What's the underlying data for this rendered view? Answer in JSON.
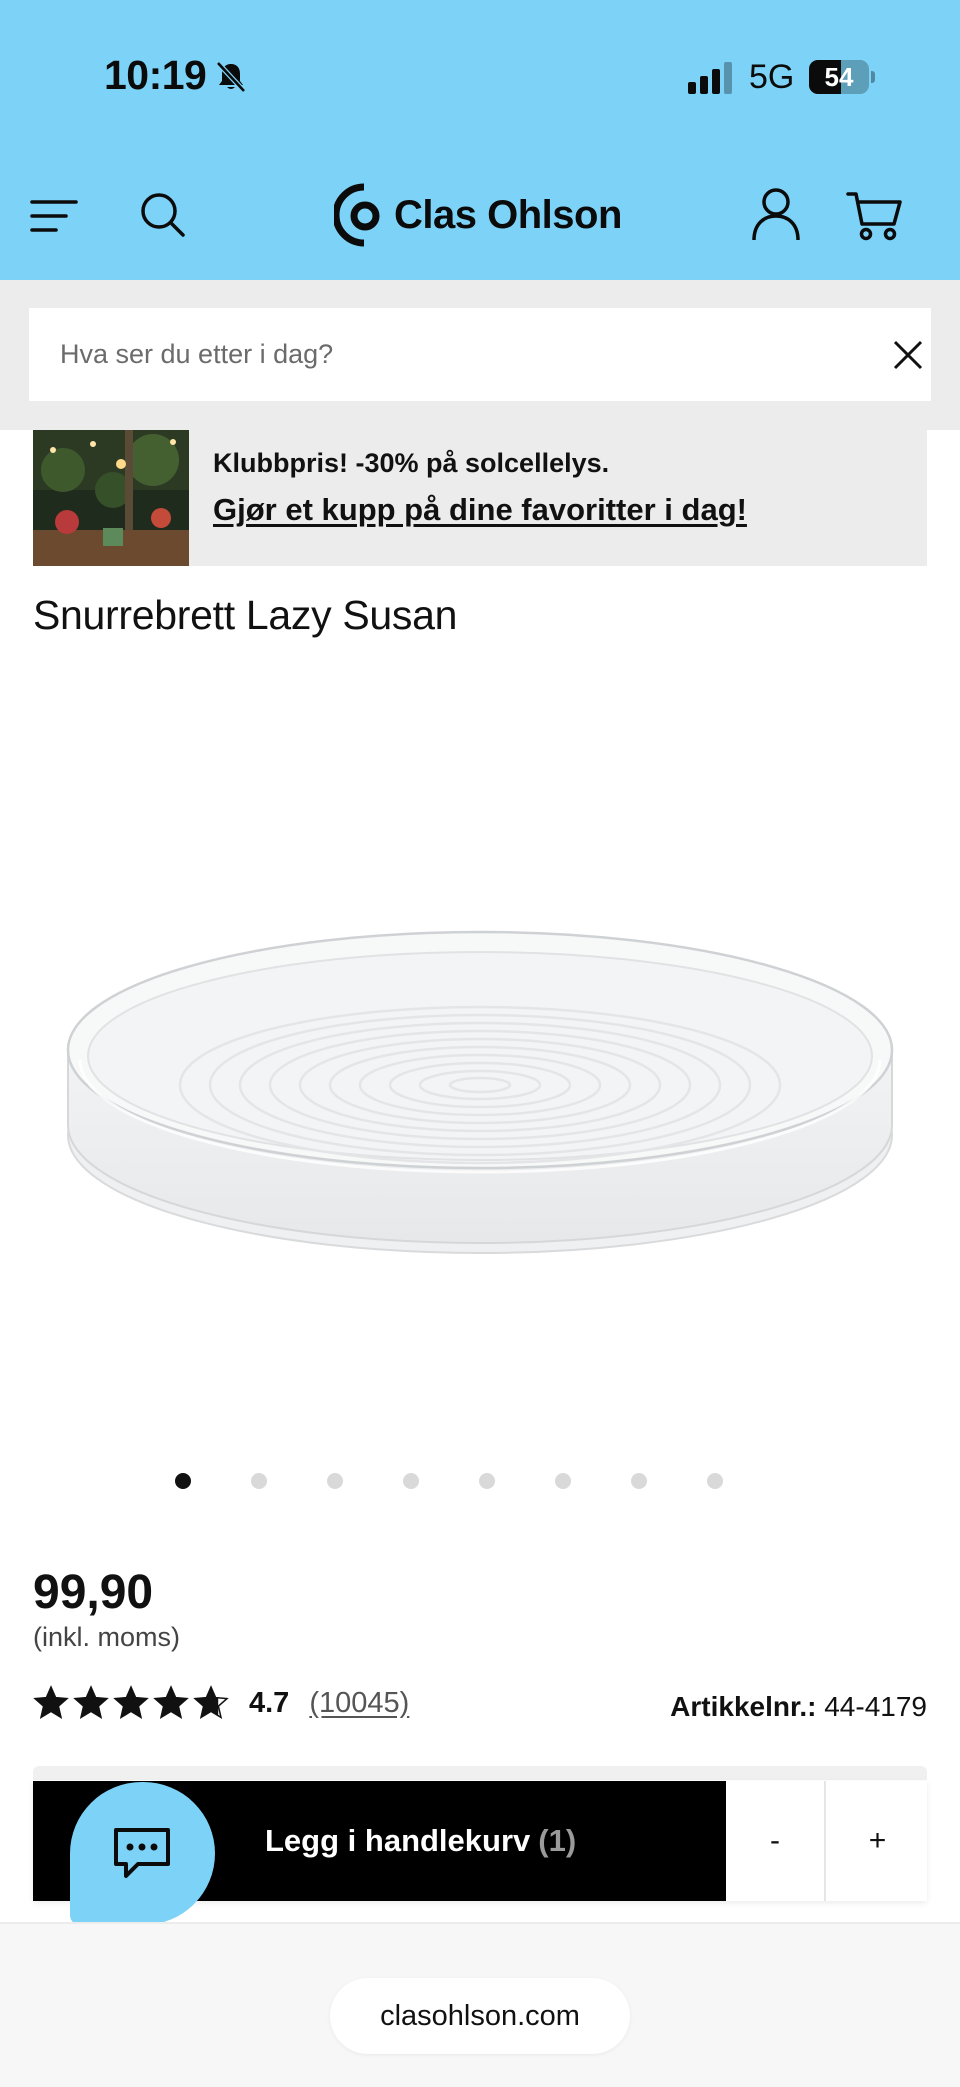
{
  "status_bar": {
    "time": "10:19",
    "network": "5G",
    "battery_level": 54,
    "battery_text": "54",
    "icons": [
      "bell-slash-icon",
      "signal-bars-icon",
      "battery-icon"
    ]
  },
  "header": {
    "brand": "Clas Ohlson",
    "icons": [
      "menu-icon",
      "search-icon",
      "clas-ohlson-logo-icon",
      "user-icon",
      "cart-icon"
    ],
    "bg_color": "#7dd3f7"
  },
  "search": {
    "placeholder": "Hva ser du etter i dag?",
    "value": ""
  },
  "promo": {
    "line1": "Klubbpris! -30% på solcellelys.",
    "line2": "Gjør et kupp på dine favoritter i dag!"
  },
  "product": {
    "title": "Snurrebrett Lazy Susan",
    "price": "99,90",
    "vat_note": "(inkl. moms)",
    "rating": 4.7,
    "rating_text": "4.7",
    "review_count": "(10045)",
    "article_label": "Artikkelnr.:",
    "article_number": "44-4179",
    "image_count": 8,
    "active_image": 0
  },
  "cart": {
    "add_label": "Legg i handlekurv",
    "count": "(1)",
    "minus": "-",
    "plus": "+"
  },
  "browser": {
    "url": "clasohlson.com"
  },
  "colors": {
    "accent": "#7dd3f7",
    "button": "#000000",
    "band": "#ececec"
  }
}
